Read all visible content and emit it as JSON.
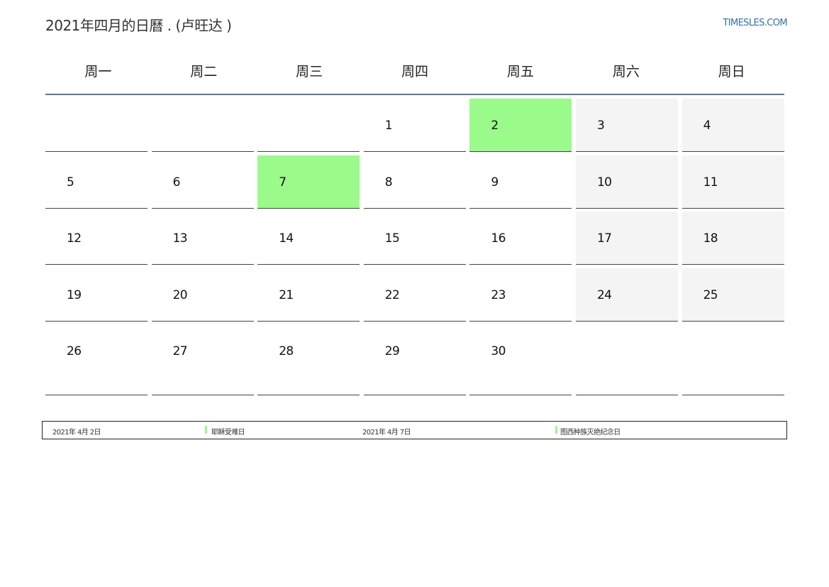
{
  "header": {
    "title": "2021年四月的日曆 . (卢旺达 )",
    "site": "TIMESLES.COM"
  },
  "colors": {
    "holiday": "#9afa8a",
    "weekend": "#f4f4f4",
    "header_rule": "#5b7797",
    "link": "#2f6fb5"
  },
  "weekdays": [
    "周一",
    "周二",
    "周三",
    "周四",
    "周五",
    "周六",
    "周日"
  ],
  "weeks": [
    [
      {
        "day": "",
        "type": "empty"
      },
      {
        "day": "",
        "type": "empty"
      },
      {
        "day": "",
        "type": "empty"
      },
      {
        "day": "1",
        "type": "normal"
      },
      {
        "day": "2",
        "type": "holiday"
      },
      {
        "day": "3",
        "type": "weekend"
      },
      {
        "day": "4",
        "type": "weekend"
      }
    ],
    [
      {
        "day": "5",
        "type": "normal"
      },
      {
        "day": "6",
        "type": "normal"
      },
      {
        "day": "7",
        "type": "holiday"
      },
      {
        "day": "8",
        "type": "normal"
      },
      {
        "day": "9",
        "type": "normal"
      },
      {
        "day": "10",
        "type": "weekend"
      },
      {
        "day": "11",
        "type": "weekend"
      }
    ],
    [
      {
        "day": "12",
        "type": "normal"
      },
      {
        "day": "13",
        "type": "normal"
      },
      {
        "day": "14",
        "type": "normal"
      },
      {
        "day": "15",
        "type": "normal"
      },
      {
        "day": "16",
        "type": "normal"
      },
      {
        "day": "17",
        "type": "weekend"
      },
      {
        "day": "18",
        "type": "weekend"
      }
    ],
    [
      {
        "day": "19",
        "type": "normal"
      },
      {
        "day": "20",
        "type": "normal"
      },
      {
        "day": "21",
        "type": "normal"
      },
      {
        "day": "22",
        "type": "normal"
      },
      {
        "day": "23",
        "type": "normal"
      },
      {
        "day": "24",
        "type": "weekend"
      },
      {
        "day": "25",
        "type": "weekend"
      }
    ],
    [
      {
        "day": "26",
        "type": "normal"
      },
      {
        "day": "27",
        "type": "normal"
      },
      {
        "day": "28",
        "type": "normal"
      },
      {
        "day": "29",
        "type": "normal"
      },
      {
        "day": "30",
        "type": "normal"
      },
      {
        "day": "",
        "type": "empty"
      },
      {
        "day": "",
        "type": "empty"
      }
    ]
  ],
  "holidays": [
    {
      "date": "2021年 4月 2日",
      "name": "耶稣受难日"
    },
    {
      "date": "2021年 4月 7日",
      "name": "图西种族灭绝纪念日"
    }
  ]
}
